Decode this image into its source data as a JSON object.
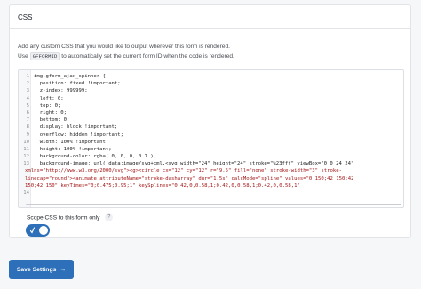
{
  "panel": {
    "title": "CSS"
  },
  "description": {
    "line1": "Add any custom CSS that you would like to output wherever this form is rendered.",
    "line2_prefix": "Use",
    "line2_code": "GFFORMID",
    "line2_suffix": "to automatically set the current form ID when the code is rendered."
  },
  "editor": {
    "lines": [
      {
        "n": "1",
        "text": "img.gform_ajax_spinner {"
      },
      {
        "n": "2",
        "text": "  position: fixed !important;"
      },
      {
        "n": "3",
        "text": "  z-index: 999999;"
      },
      {
        "n": "4",
        "text": "  left: 0;"
      },
      {
        "n": "5",
        "text": "  top: 0;"
      },
      {
        "n": "6",
        "text": "  right: 0;"
      },
      {
        "n": "7",
        "text": "  bottom: 0;"
      },
      {
        "n": "8",
        "text": "  display: block !important;"
      },
      {
        "n": "9",
        "text": "  overflow: hidden !important;"
      },
      {
        "n": "10",
        "text": "  width: 100% !important;"
      },
      {
        "n": "11",
        "text": "  height: 100% !important;"
      },
      {
        "n": "12",
        "text": "  background-color: rgba( 0, 0, 0, 0.7 );"
      },
      {
        "n": "13",
        "text": "  background-image: url('data:image/svg+xml,<svg width=\"24\" height=\"24\" stroke=\"%23fff\" viewBox=\"0 0 24 24\""
      }
    ],
    "continuation": [
      "xmlns=\"http://www.w3.org/2000/svg\"><g><circle cx=\"12\" cy=\"12\" r=\"9.5\" fill=\"none\" stroke-width=\"3\" stroke-",
      "linecap=\"round\"><animate attributeName=\"stroke-dasharray\" dur=\"1.5s\" calcMode=\"spline\" values=\"0 150;42 150;42",
      "150;42 150\" keyTimes=\"0;0.475;0.95;1\" keySplines=\"0.42,0,0.58,1;0.42,0,0.58,1;0.42,0,0.58,1\""
    ],
    "last_line_number": "14"
  },
  "scope": {
    "label": "Scope CSS to this form only",
    "help": "?",
    "enabled": true
  },
  "save_button": {
    "label": "Save Settings",
    "arrow": "→"
  },
  "colors": {
    "accent": "#2d6fb8",
    "border": "#e2e4e8",
    "background": "#f6f7f9"
  }
}
